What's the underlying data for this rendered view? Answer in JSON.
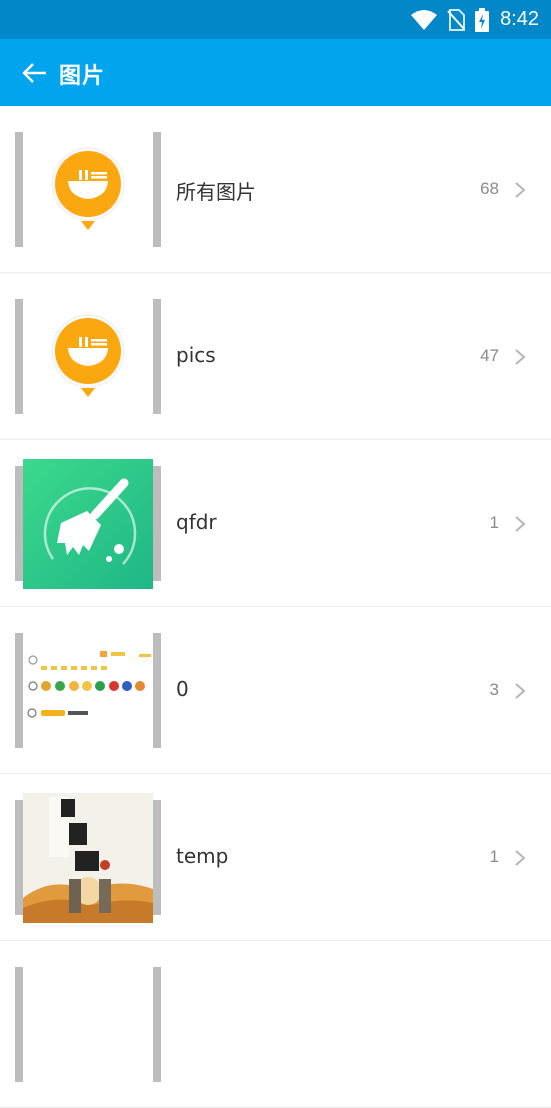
{
  "status_bar": {
    "time": "8:42",
    "icons": [
      "wifi-icon",
      "no-sim-icon",
      "battery-charging-icon"
    ]
  },
  "app_bar": {
    "back_icon": "arrow-left-icon",
    "title": "图片"
  },
  "albums": [
    {
      "name": "所有图片",
      "count": "68",
      "thumb": "app-logo-bowl"
    },
    {
      "name": "pics",
      "count": "47",
      "thumb": "app-logo-bowl"
    },
    {
      "name": "qfdr",
      "count": "1",
      "thumb": "broom-cleaner-icon"
    },
    {
      "name": "0",
      "count": "3",
      "thumb": "emoji-screenshot"
    },
    {
      "name": "temp",
      "count": "1",
      "thumb": "poster-image"
    }
  ],
  "colors": {
    "status_bar": "#0288c9",
    "app_bar": "#03a4ee",
    "logo_orange": "#fba70f",
    "cleaner_green": "#2fcf86"
  }
}
